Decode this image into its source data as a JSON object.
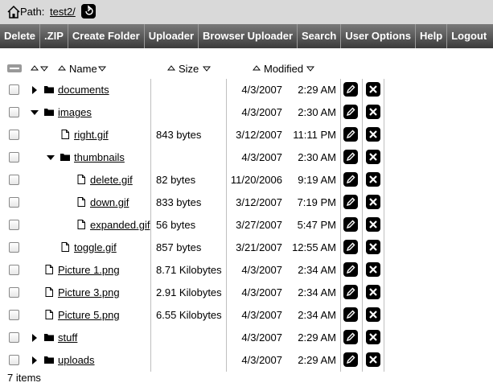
{
  "pathbar": {
    "label": "Path:",
    "path": "test2/"
  },
  "toolbar": {
    "buttons": [
      "Delete",
      ".ZIP",
      "Create Folder",
      "Uploader",
      "Browser Uploader",
      "Search",
      "User Options",
      "Help",
      "Logout"
    ]
  },
  "columns": {
    "name": "Name",
    "size": "Size",
    "modified": "Modified"
  },
  "rows": [
    {
      "name": "documents",
      "type": "folder",
      "level": 0,
      "toggle": "collapsed",
      "size": "",
      "date": "4/3/2007",
      "time": "2:29 AM"
    },
    {
      "name": "images",
      "type": "folder",
      "level": 0,
      "toggle": "expanded",
      "size": "",
      "date": "4/3/2007",
      "time": "2:30 AM"
    },
    {
      "name": "right.gif",
      "type": "file",
      "level": 1,
      "toggle": "",
      "size": "843 bytes",
      "date": "3/12/2007",
      "time": "11:11 PM"
    },
    {
      "name": "thumbnails",
      "type": "folder",
      "level": 1,
      "toggle": "expanded",
      "size": "",
      "date": "4/3/2007",
      "time": "2:30 AM"
    },
    {
      "name": "delete.gif",
      "type": "file",
      "level": 2,
      "toggle": "",
      "size": "82 bytes",
      "date": "11/20/2006",
      "time": "9:19 AM"
    },
    {
      "name": "down.gif",
      "type": "file",
      "level": 2,
      "toggle": "",
      "size": "833 bytes",
      "date": "3/12/2007",
      "time": "7:19 PM"
    },
    {
      "name": "expanded.gif",
      "type": "file",
      "level": 2,
      "toggle": "",
      "size": "56 bytes",
      "date": "3/27/2007",
      "time": "5:47 PM"
    },
    {
      "name": "toggle.gif",
      "type": "file",
      "level": 1,
      "toggle": "",
      "size": "857 bytes",
      "date": "3/21/2007",
      "time": "12:55 AM"
    },
    {
      "name": "Picture 1.png",
      "type": "file",
      "level": 0,
      "toggle": "",
      "size": "8.71 Kilobytes",
      "date": "4/3/2007",
      "time": "2:34 AM"
    },
    {
      "name": "Picture 3.png",
      "type": "file",
      "level": 0,
      "toggle": "",
      "size": "2.91 Kilobytes",
      "date": "4/3/2007",
      "time": "2:34 AM"
    },
    {
      "name": "Picture 5.png",
      "type": "file",
      "level": 0,
      "toggle": "",
      "size": "6.55 Kilobytes",
      "date": "4/3/2007",
      "time": "2:34 AM"
    },
    {
      "name": "stuff",
      "type": "folder",
      "level": 0,
      "toggle": "collapsed",
      "size": "",
      "date": "4/3/2007",
      "time": "2:29 AM"
    },
    {
      "name": "uploads",
      "type": "folder",
      "level": 0,
      "toggle": "collapsed",
      "size": "",
      "date": "4/3/2007",
      "time": "2:29 AM"
    }
  ],
  "footer": {
    "count": "7 items"
  },
  "colors": {
    "toolbar_top": "#7a7a7a",
    "toolbar_bottom": "#3b3b3b",
    "pathbar_bg": "#d9d9d9"
  }
}
